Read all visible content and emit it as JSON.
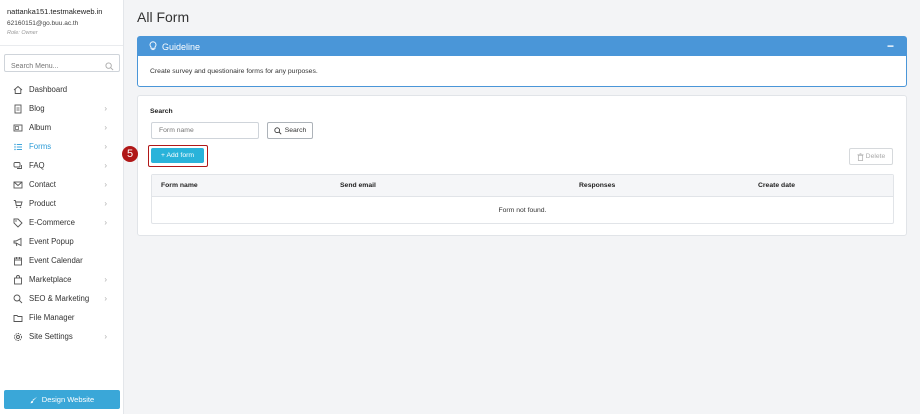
{
  "sidebar": {
    "domain": "nattanka151.testmakeweb.in",
    "email": "62160151@go.buu.ac.th",
    "role": "Role: Owner",
    "search_placeholder": "Search Menu...",
    "items": [
      {
        "label": "Dashboard",
        "icon": "home-icon",
        "chevron": false
      },
      {
        "label": "Blog",
        "icon": "document-icon",
        "chevron": true
      },
      {
        "label": "Album",
        "icon": "album-icon",
        "chevron": true
      },
      {
        "label": "Forms",
        "icon": "list-icon",
        "chevron": true,
        "active": true
      },
      {
        "label": "FAQ",
        "icon": "chat-icon",
        "chevron": true
      },
      {
        "label": "Contact",
        "icon": "mail-icon",
        "chevron": true
      },
      {
        "label": "Product",
        "icon": "cart-icon",
        "chevron": true
      },
      {
        "label": "E-Commerce",
        "icon": "tag-icon",
        "chevron": true
      },
      {
        "label": "Event Popup",
        "icon": "megaphone-icon",
        "chevron": false
      },
      {
        "label": "Event Calendar",
        "icon": "calendar-icon",
        "chevron": false
      },
      {
        "label": "Marketplace",
        "icon": "bag-icon",
        "chevron": true
      },
      {
        "label": "SEO & Marketing",
        "icon": "search-icon",
        "chevron": true
      },
      {
        "label": "File Manager",
        "icon": "folder-icon",
        "chevron": false
      },
      {
        "label": "Site Settings",
        "icon": "gear-icon",
        "chevron": true
      }
    ],
    "design_button": "Design Website"
  },
  "main": {
    "title": "All Form",
    "guideline": {
      "title": "Guideline",
      "collapse": "−",
      "text": "Create survey and questionaire forms for any purposes."
    },
    "search": {
      "label": "Search",
      "placeholder": "Form name",
      "button": "Search"
    },
    "step_badge": "5",
    "add_button": "+ Add form",
    "delete_button": "Delete",
    "table": {
      "columns": [
        "Form name",
        "Send email",
        "Responses",
        "Create date"
      ],
      "empty_message": "Form not found."
    }
  },
  "colors": {
    "accent": "#4a96d8",
    "add_button": "#29b3da",
    "highlight": "#b01818",
    "active_menu": "#2b9bd7"
  }
}
